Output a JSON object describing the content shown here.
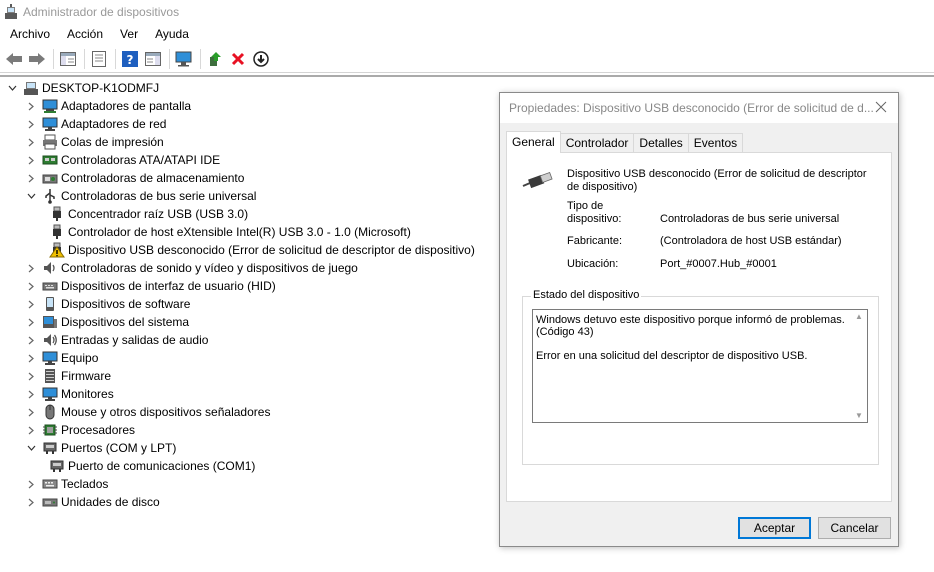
{
  "window": {
    "title": "Administrador de dispositivos"
  },
  "menu": [
    "Archivo",
    "Acción",
    "Ver",
    "Ayuda"
  ],
  "toolbar": {
    "icons": [
      "back-icon",
      "forward-icon",
      "show-hide-console-tree-icon",
      "properties-icon",
      "help-icon",
      "action-pane-icon",
      "scan-hardware-icon",
      "update-driver-icon",
      "uninstall-icon",
      "disable-device-icon"
    ]
  },
  "tree": {
    "root": "DESKTOP-K1ODMFJ",
    "items": [
      {
        "label": "Adaptadores de pantalla",
        "icon": "display-adapter-icon",
        "expanded": false,
        "level": 1
      },
      {
        "label": "Adaptadores de red",
        "icon": "network-adapter-icon",
        "expanded": false,
        "level": 1
      },
      {
        "label": "Colas de impresión",
        "icon": "print-queue-icon",
        "expanded": false,
        "level": 1
      },
      {
        "label": "Controladoras ATA/ATAPI IDE",
        "icon": "ide-controller-icon",
        "expanded": false,
        "level": 1
      },
      {
        "label": "Controladoras de almacenamiento",
        "icon": "storage-controller-icon",
        "expanded": false,
        "level": 1
      },
      {
        "label": "Controladoras de bus serie universal",
        "icon": "usb-controller-icon",
        "expanded": true,
        "level": 1
      },
      {
        "label": "Concentrador raíz USB (USB 3.0)",
        "icon": "usb-device-icon",
        "level": 2
      },
      {
        "label": "Controlador de host eXtensible Intel(R) USB 3.0 - 1.0 (Microsoft)",
        "icon": "usb-device-icon",
        "level": 2
      },
      {
        "label": "Dispositivo USB desconocido (Error de solicitud de descriptor de dispositivo)",
        "icon": "warning-icon",
        "level": 2
      },
      {
        "label": "Controladoras de sonido y vídeo y dispositivos de juego",
        "icon": "sound-icon",
        "expanded": false,
        "level": 1
      },
      {
        "label": "Dispositivos de interfaz de usuario (HID)",
        "icon": "hid-icon",
        "expanded": false,
        "level": 1
      },
      {
        "label": "Dispositivos de software",
        "icon": "software-device-icon",
        "expanded": false,
        "level": 1
      },
      {
        "label": "Dispositivos del sistema",
        "icon": "system-device-icon",
        "expanded": false,
        "level": 1
      },
      {
        "label": "Entradas y salidas de audio",
        "icon": "audio-io-icon",
        "expanded": false,
        "level": 1
      },
      {
        "label": "Equipo",
        "icon": "computer-icon",
        "expanded": false,
        "level": 1
      },
      {
        "label": "Firmware",
        "icon": "firmware-icon",
        "expanded": false,
        "level": 1
      },
      {
        "label": "Monitores",
        "icon": "monitor-icon",
        "expanded": false,
        "level": 1
      },
      {
        "label": "Mouse y otros dispositivos señaladores",
        "icon": "mouse-icon",
        "expanded": false,
        "level": 1
      },
      {
        "label": "Procesadores",
        "icon": "processor-icon",
        "expanded": false,
        "level": 1
      },
      {
        "label": "Puertos (COM y LPT)",
        "icon": "ports-icon",
        "expanded": true,
        "level": 1
      },
      {
        "label": "Puerto de comunicaciones (COM1)",
        "icon": "com-port-icon",
        "level": 2
      },
      {
        "label": "Teclados",
        "icon": "keyboard-icon",
        "expanded": false,
        "level": 1
      },
      {
        "label": "Unidades de disco",
        "icon": "disk-drive-icon",
        "expanded": false,
        "level": 1
      }
    ]
  },
  "dialog": {
    "title": "Propiedades: Dispositivo USB desconocido (Error de solicitud de d...",
    "tabs": [
      "General",
      "Controlador",
      "Detalles",
      "Eventos"
    ],
    "active_tab": "General",
    "device_name": "Dispositivo USB desconocido (Error de solicitud de descriptor de dispositivo)",
    "props": {
      "type_label": "Tipo de\ndispositivo:",
      "type_value": "Controladoras de bus serie universal",
      "manufacturer_label": "Fabricante:",
      "manufacturer_value": "(Controladora de host USB estándar)",
      "location_label": "Ubicación:",
      "location_value": "Port_#0007.Hub_#0001"
    },
    "status_legend": "Estado del dispositivo",
    "status_text": "Windows detuvo este dispositivo porque informó de problemas. (Código 43)\n\nError en una solicitud del descriptor de dispositivo USB.",
    "ok_label": "Aceptar",
    "cancel_label": "Cancelar"
  },
  "colors": {
    "accent": "#0078d7",
    "warning": "#f0c000",
    "error": "#e81123"
  }
}
